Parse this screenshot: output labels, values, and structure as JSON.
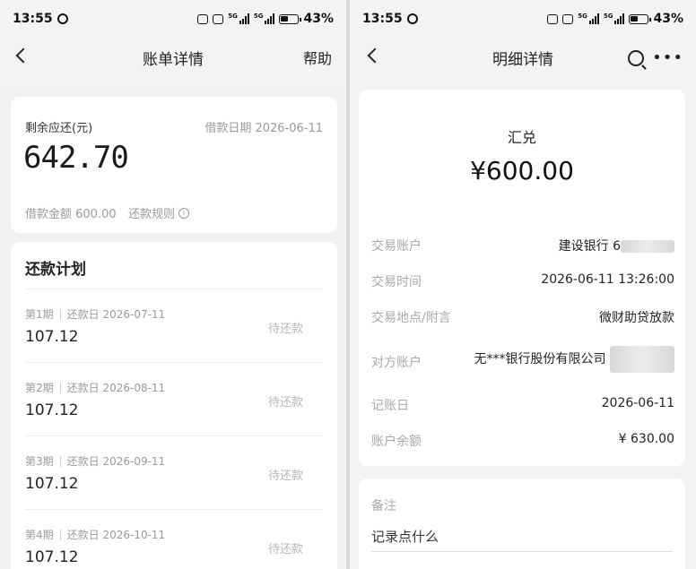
{
  "left": {
    "status": {
      "time": "13:55",
      "battery": "43%",
      "net1": "5G",
      "net2": "5G"
    },
    "nav": {
      "title": "账单详情",
      "help": "帮助"
    },
    "summary": {
      "remaining_label": "剩余应还(元)",
      "loan_date": "借款日期 2026-06-11",
      "remaining_amount": "642.70",
      "loan_amount": "借款金额 600.00",
      "repay_rules": "还款规则"
    },
    "plan": {
      "title": "还款计划",
      "rows": [
        {
          "period": "第1期",
          "due": "还款日 2026-07-11",
          "amount": "107.12",
          "status": "待还款"
        },
        {
          "period": "第2期",
          "due": "还款日 2026-08-11",
          "amount": "107.12",
          "status": "待还款"
        },
        {
          "period": "第3期",
          "due": "还款日 2026-09-11",
          "amount": "107.12",
          "status": "待还款"
        },
        {
          "period": "第4期",
          "due": "还款日 2026-10-11",
          "amount": "107.12",
          "status": "待还款"
        }
      ]
    }
  },
  "right": {
    "status": {
      "time": "13:55",
      "battery": "43%",
      "net1": "5G",
      "net2": "5G"
    },
    "nav": {
      "title": "明细详情"
    },
    "detail": {
      "type": "汇兑",
      "amount": "¥600.00",
      "rows": [
        {
          "key": "交易账户",
          "value": "建设银行 6"
        },
        {
          "key": "交易时间",
          "value": "2026-06-11 13:26:00"
        },
        {
          "key": "交易地点/附言",
          "value": "微财助贷放款"
        },
        {
          "key": "对方账户",
          "value": "无***银行股份有限公司 "
        },
        {
          "key": "记账日",
          "value": "2026-06-11"
        },
        {
          "key": "账户余额",
          "value": "¥ 630.00"
        }
      ]
    },
    "memo": {
      "label": "备注",
      "placeholder": "记录点什么"
    }
  }
}
